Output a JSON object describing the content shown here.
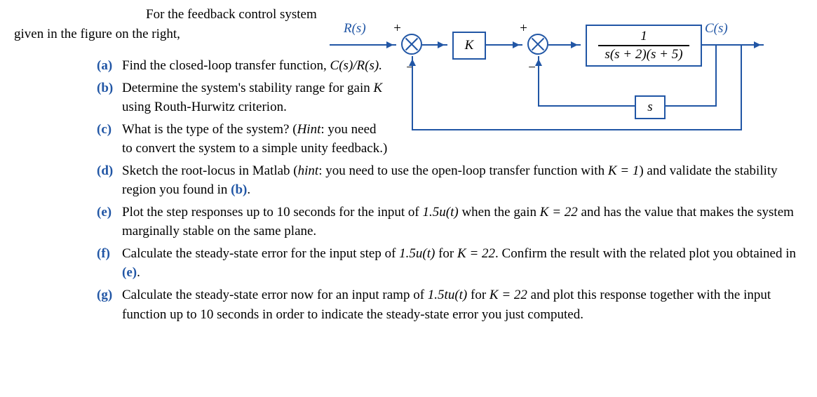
{
  "intro1": "For the feedback control system",
  "intro2": "given in the figure on the right,",
  "items": [
    {
      "lbl": "(a)",
      "pre": "Find the closed-loop transfer function, ",
      "math": "C(s)/R(s).",
      "post": ""
    },
    {
      "lbl": "(b)",
      "pre": "Determine the system's stability range for gain ",
      "math": "K",
      "post": " using Routh-Hurwitz criterion."
    },
    {
      "lbl": "(c)",
      "pre": "What is the type of the system? (",
      "math": "Hint",
      "post": ": you need to convert the system to a simple unity feedback.)"
    },
    {
      "lbl": "(d)",
      "pre": "Sketch the root-locus in Matlab (",
      "math": "hint",
      "post": ": you need to use the open-loop transfer function with ",
      "math2": "K = 1",
      "post2": ") and validate the stability region you found in ",
      "ref": "(b)",
      "tail": "."
    },
    {
      "lbl": "(e)",
      "pre": "Plot the step responses up to 10 seconds for the input of ",
      "math": "1.5u(t)",
      "post": " when the gain ",
      "math2": "K = 22",
      "post2": " and has the value that makes the system marginally stable on the same plane."
    },
    {
      "lbl": "(f)",
      "pre": "Calculate the steady-state error for the input step of ",
      "math": "1.5u(t)",
      "post": " for ",
      "math2": "K = 22",
      "post2": ". Confirm the result with the related plot you obtained in ",
      "ref": "(e)",
      "tail": "."
    },
    {
      "lbl": "(g)",
      "pre": "Calculate the steady-state error now for an input ramp of ",
      "math": "1.5tu(t)",
      "post": " for ",
      "math2": "K = 22",
      "post2": " and plot this response together with the input function up to 10 seconds in order to indicate the steady-state error you just computed."
    }
  ],
  "diagram": {
    "R": "R(s)",
    "plus": "+",
    "minus": "−",
    "K": "K",
    "C": "C(s)",
    "S": "s",
    "tf_num": "1",
    "tf_den": "s(s + 2)(s + 5)"
  }
}
